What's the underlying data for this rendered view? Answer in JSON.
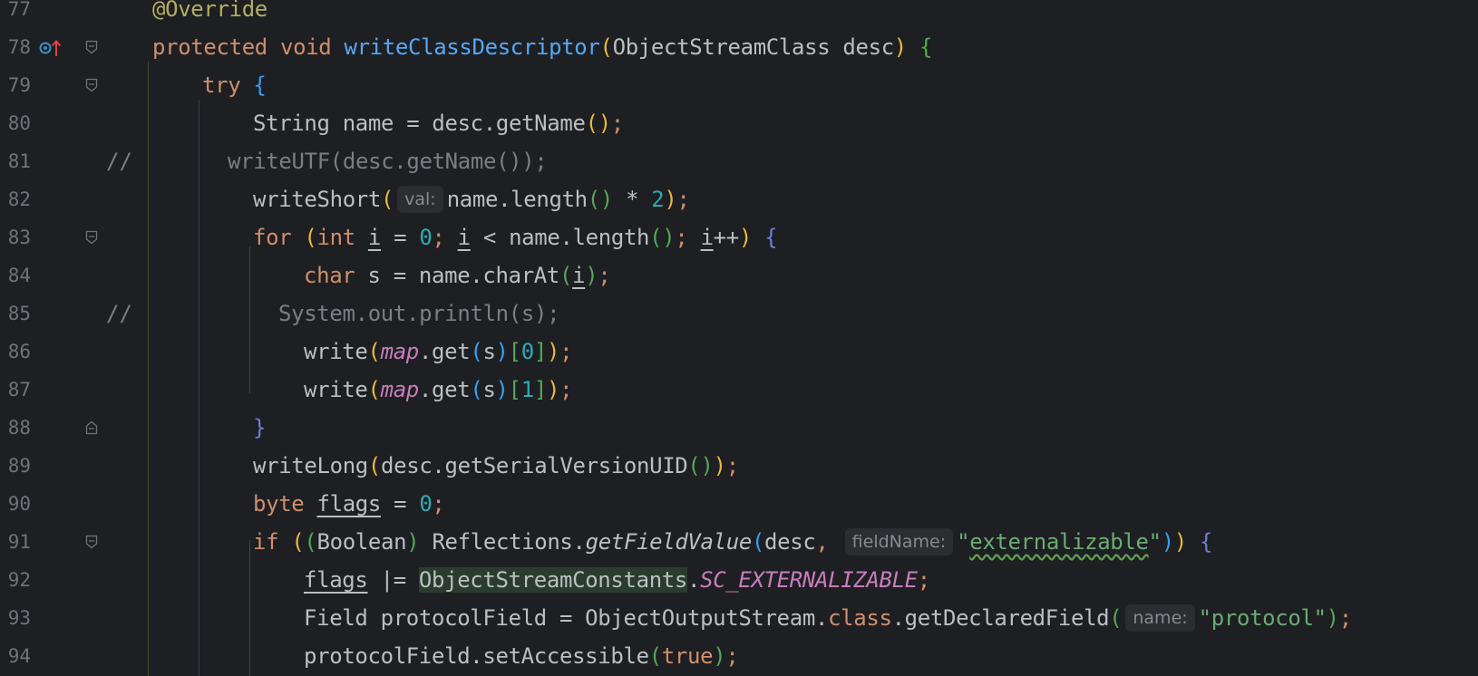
{
  "editor": {
    "lines": [
      {
        "num": "77",
        "tokens": [
          {
            "t": "@Override",
            "c": "ann"
          }
        ]
      },
      {
        "num": "78",
        "tokens": [
          {
            "t": "protected void ",
            "c": "kw"
          },
          {
            "t": "writeClassDescriptor",
            "c": "fn"
          },
          {
            "t": "(",
            "c": "b1"
          },
          {
            "t": "ObjectStreamClass desc",
            "c": "txt"
          },
          {
            "t": ")",
            "c": "b1"
          },
          {
            "t": " {",
            "c": "b2"
          }
        ]
      },
      {
        "num": "79",
        "tokens": [
          {
            "t": "try ",
            "c": "kw"
          },
          {
            "t": "{",
            "c": "b3"
          }
        ]
      },
      {
        "num": "80",
        "tokens": [
          {
            "t": "String name = desc.getName",
            "c": "txt"
          },
          {
            "t": "()",
            "c": "b1"
          },
          {
            "t": ";",
            "c": "kw"
          }
        ]
      },
      {
        "num": "81",
        "comment_prefix": "//",
        "tokens": [
          {
            "t": "writeUTF(desc.getName());",
            "c": "cmt"
          }
        ]
      },
      {
        "num": "82",
        "tokens": [
          {
            "t": "writeShort",
            "c": "txt"
          },
          {
            "t": "(",
            "c": "b1"
          },
          {
            "hint": "val:"
          },
          {
            "t": "name.length",
            "c": "txt"
          },
          {
            "t": "()",
            "c": "b2"
          },
          {
            "t": " * ",
            "c": "txt"
          },
          {
            "t": "2",
            "c": "num"
          },
          {
            "t": ")",
            "c": "b1"
          },
          {
            "t": ";",
            "c": "kw"
          }
        ]
      },
      {
        "num": "83",
        "tokens": [
          {
            "t": "for ",
            "c": "kw"
          },
          {
            "t": "(",
            "c": "b1"
          },
          {
            "t": "int ",
            "c": "kw"
          },
          {
            "t": "i",
            "c": "txt",
            "u": true
          },
          {
            "t": " = ",
            "c": "txt"
          },
          {
            "t": "0",
            "c": "num"
          },
          {
            "t": "; ",
            "c": "kw"
          },
          {
            "t": "i",
            "c": "txt",
            "u": true
          },
          {
            "t": " < name.length",
            "c": "txt"
          },
          {
            "t": "()",
            "c": "b2"
          },
          {
            "t": "; ",
            "c": "kw"
          },
          {
            "t": "i",
            "c": "txt",
            "u": true
          },
          {
            "t": "++",
            "c": "txt"
          },
          {
            "t": ")",
            "c": "b1"
          },
          {
            "t": " {",
            "c": "b4"
          }
        ]
      },
      {
        "num": "84",
        "tokens": [
          {
            "t": "char ",
            "c": "kw"
          },
          {
            "t": "s = name.charAt",
            "c": "txt"
          },
          {
            "t": "(",
            "c": "b2"
          },
          {
            "t": "i",
            "c": "txt",
            "u": true
          },
          {
            "t": ")",
            "c": "b2"
          },
          {
            "t": ";",
            "c": "kw"
          }
        ]
      },
      {
        "num": "85",
        "comment_prefix": "//",
        "tokens": [
          {
            "t": "System.out.println(s);",
            "c": "cmt"
          }
        ]
      },
      {
        "num": "86",
        "tokens": [
          {
            "t": "write",
            "c": "txt"
          },
          {
            "t": "(",
            "c": "b1"
          },
          {
            "t": "map",
            "c": "field"
          },
          {
            "t": ".get",
            "c": "txt"
          },
          {
            "t": "(",
            "c": "b3"
          },
          {
            "t": "s",
            "c": "txt"
          },
          {
            "t": ")",
            "c": "b3"
          },
          {
            "t": "[",
            "c": "b2"
          },
          {
            "t": "0",
            "c": "num"
          },
          {
            "t": "]",
            "c": "b2"
          },
          {
            "t": ")",
            "c": "b1"
          },
          {
            "t": ";",
            "c": "kw"
          }
        ]
      },
      {
        "num": "87",
        "tokens": [
          {
            "t": "write",
            "c": "txt"
          },
          {
            "t": "(",
            "c": "b1"
          },
          {
            "t": "map",
            "c": "field"
          },
          {
            "t": ".get",
            "c": "txt"
          },
          {
            "t": "(",
            "c": "b3"
          },
          {
            "t": "s",
            "c": "txt"
          },
          {
            "t": ")",
            "c": "b3"
          },
          {
            "t": "[",
            "c": "b2"
          },
          {
            "t": "1",
            "c": "num"
          },
          {
            "t": "]",
            "c": "b2"
          },
          {
            "t": ")",
            "c": "b1"
          },
          {
            "t": ";",
            "c": "kw"
          }
        ]
      },
      {
        "num": "88",
        "tokens": [
          {
            "t": "}",
            "c": "b4"
          }
        ]
      },
      {
        "num": "89",
        "tokens": [
          {
            "t": "writeLong",
            "c": "txt"
          },
          {
            "t": "(",
            "c": "b1"
          },
          {
            "t": "desc.getSerialVersionUID",
            "c": "txt"
          },
          {
            "t": "()",
            "c": "b2"
          },
          {
            "t": ")",
            "c": "b1"
          },
          {
            "t": ";",
            "c": "kw"
          }
        ]
      },
      {
        "num": "90",
        "tokens": [
          {
            "t": "byte ",
            "c": "kw"
          },
          {
            "t": "flags",
            "c": "txt",
            "u": true
          },
          {
            "t": " = ",
            "c": "txt"
          },
          {
            "t": "0",
            "c": "num"
          },
          {
            "t": ";",
            "c": "kw"
          }
        ]
      },
      {
        "num": "91",
        "tokens": [
          {
            "t": "if ",
            "c": "kw"
          },
          {
            "t": "(",
            "c": "b1"
          },
          {
            "t": "(",
            "c": "b2"
          },
          {
            "t": "Boolean",
            "c": "txt"
          },
          {
            "t": ")",
            "c": "b2"
          },
          {
            "t": " Reflections.",
            "c": "txt"
          },
          {
            "t": "getFieldValue",
            "c": "txt",
            "i": true
          },
          {
            "t": "(",
            "c": "b3"
          },
          {
            "t": "desc",
            "c": "txt"
          },
          {
            "t": ", ",
            "c": "kw"
          },
          {
            "hint": "fieldName:"
          },
          {
            "t": "\"",
            "c": "str"
          },
          {
            "t": "externalizable",
            "c": "str",
            "wavy": true
          },
          {
            "t": "\"",
            "c": "str"
          },
          {
            "t": ")",
            "c": "b3"
          },
          {
            "t": ")",
            "c": "b1"
          },
          {
            "t": " {",
            "c": "b4"
          }
        ]
      },
      {
        "num": "92",
        "tokens": [
          {
            "t": "flags",
            "c": "txt",
            "u": true
          },
          {
            "t": " |= ",
            "c": "txt"
          },
          {
            "t": "ObjectStreamConstants",
            "c": "txt",
            "hl": true
          },
          {
            "t": ".",
            "c": "txt"
          },
          {
            "t": "SC_EXTERNALIZABLE",
            "c": "field"
          },
          {
            "t": ";",
            "c": "kw"
          }
        ]
      },
      {
        "num": "93",
        "tokens": [
          {
            "t": "Field protocolField = ObjectOutputStream.",
            "c": "txt"
          },
          {
            "t": "class",
            "c": "kw"
          },
          {
            "t": ".getDeclaredField",
            "c": "txt"
          },
          {
            "t": "(",
            "c": "b2"
          },
          {
            "hint": "name:"
          },
          {
            "t": "\"protocol\"",
            "c": "str"
          },
          {
            "t": ")",
            "c": "b2"
          },
          {
            "t": ";",
            "c": "kw"
          }
        ]
      },
      {
        "num": "94",
        "tokens": [
          {
            "t": "protocolField.setAccessible",
            "c": "txt"
          },
          {
            "t": "(",
            "c": "b2"
          },
          {
            "t": "true",
            "c": "kw"
          },
          {
            "t": ")",
            "c": "b2"
          },
          {
            "t": ";",
            "c": "kw"
          }
        ]
      }
    ]
  }
}
